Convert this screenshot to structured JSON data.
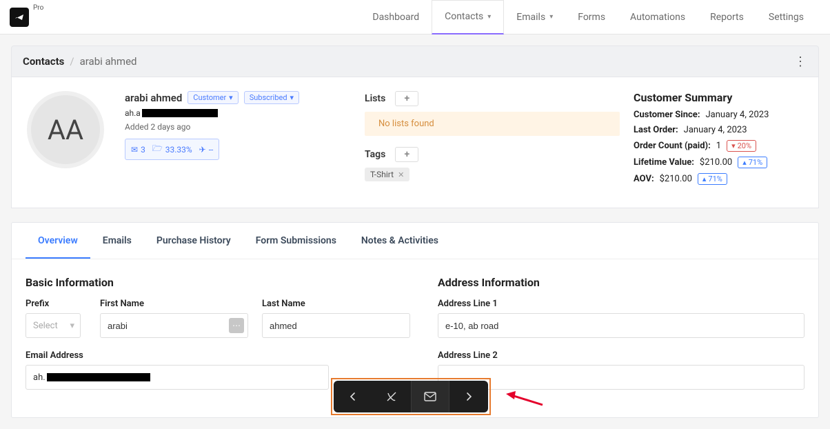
{
  "logo_pro": "Pro",
  "nav": {
    "dashboard": "Dashboard",
    "contacts": "Contacts",
    "emails": "Emails",
    "forms": "Forms",
    "automations": "Automations",
    "reports": "Reports",
    "settings": "Settings"
  },
  "breadcrumb": {
    "root": "Contacts",
    "name": "arabi ahmed"
  },
  "contact": {
    "initials": "AA",
    "name": "arabi ahmed",
    "badge_customer": "Customer",
    "badge_subscribed": "Subscribed",
    "email_prefix": "ah.a",
    "added": "Added 2 days ago",
    "stat_mail": "3",
    "stat_folder": "33.33%",
    "stat_send": "--"
  },
  "lists": {
    "label": "Lists",
    "empty": "No lists found"
  },
  "tags": {
    "label": "Tags",
    "items": [
      "T-Shirt"
    ]
  },
  "summary": {
    "title": "Customer Summary",
    "since_label": "Customer Since:",
    "since_val": "January 4, 2023",
    "last_label": "Last Order:",
    "last_val": "January 4, 2023",
    "orders_label": "Order Count (paid):",
    "orders_val": "1",
    "orders_pct": "20%",
    "lifetime_label": "Lifetime Value:",
    "lifetime_val": "$210.00",
    "lifetime_pct": "71%",
    "aov_label": "AOV:",
    "aov_val": "$210.00",
    "aov_pct": "71%"
  },
  "tabs": {
    "overview": "Overview",
    "emails": "Emails",
    "purchase": "Purchase History",
    "forms": "Form Submissions",
    "notes": "Notes & Activities"
  },
  "form": {
    "basic_title": "Basic Information",
    "address_title": "Address Information",
    "prefix_label": "Prefix",
    "prefix_placeholder": "Select",
    "first_label": "First Name",
    "first_val": "arabi",
    "last_label": "Last Name",
    "last_val": "ahmed",
    "email_label": "Email Address",
    "email_prefix_val": "ah.",
    "addr1_label": "Address Line 1",
    "addr1_val": "e-10, ab road",
    "addr2_label": "Address Line 2"
  }
}
